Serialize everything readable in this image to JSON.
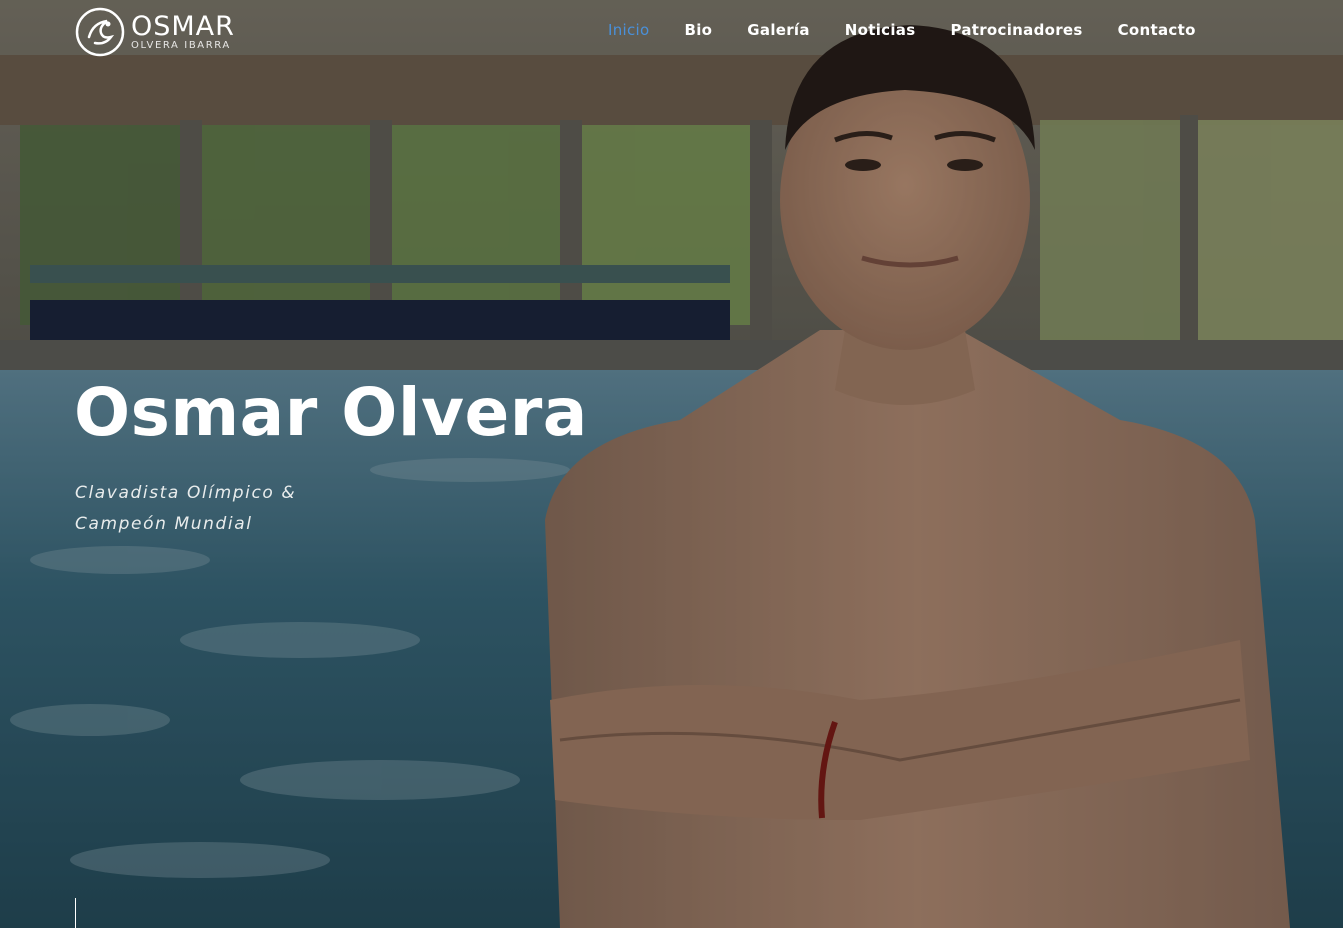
{
  "header": {
    "logo": {
      "main_text": "OSMAR",
      "sub_text": "OLVERA IBARRA",
      "icon": "diver-swirl-logo-icon"
    },
    "nav": [
      {
        "label": "Inicio",
        "active": true
      },
      {
        "label": "Bio",
        "active": false
      },
      {
        "label": "Galería",
        "active": false
      },
      {
        "label": "Noticias",
        "active": false
      },
      {
        "label": "Patrocinadores",
        "active": false
      },
      {
        "label": "Contacto",
        "active": false
      }
    ]
  },
  "hero": {
    "title": "Osmar Olvera",
    "subtitle_line1": "Clavadista Olímpico &",
    "subtitle_line2": "Campeón Mundial",
    "background": "swimmer-portrait-at-indoor-pool"
  },
  "colors": {
    "nav_active": "#4a90d9",
    "nav_text": "#ffffff",
    "title_text": "#ffffff"
  }
}
